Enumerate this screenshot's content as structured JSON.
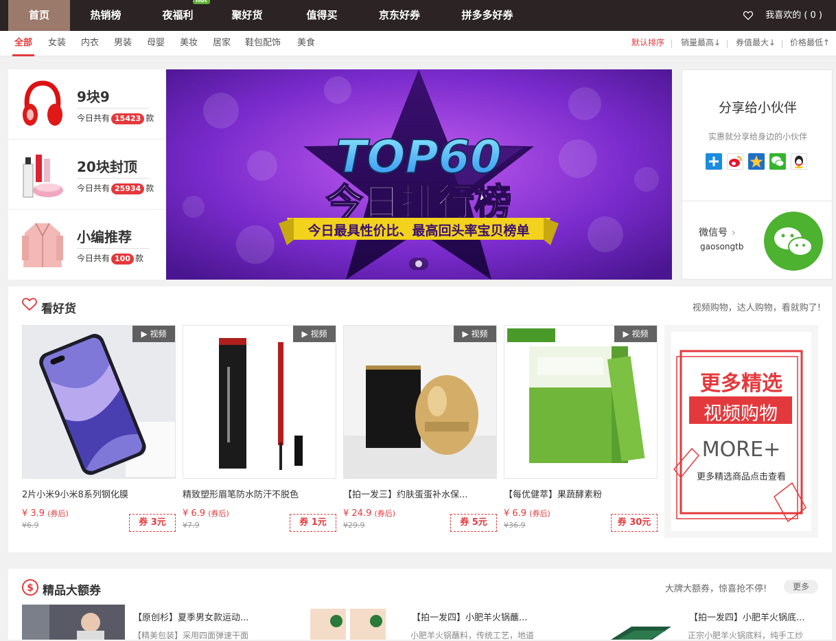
{
  "nav": {
    "items": [
      "首页",
      "热销榜",
      "夜福利",
      "聚好货",
      "值得买",
      "京东好券",
      "拼多多好券"
    ],
    "hot_tag": "hot",
    "favorites": "我喜欢的 ( 0 )"
  },
  "categories": [
    "全部",
    "女装",
    "内衣",
    "男装",
    "母婴",
    "美妆",
    "居家",
    "鞋包配饰",
    "美食"
  ],
  "sort": [
    "默认排序",
    "销量最高↓",
    "券值最大↓",
    "价格最低↑"
  ],
  "left_panel": [
    {
      "title": "9块9",
      "prefix": "今日共有",
      "count": "15423",
      "suffix": "款"
    },
    {
      "title": "20块封顶",
      "prefix": "今日共有",
      "count": "25934",
      "suffix": "款"
    },
    {
      "title": "小编推荐",
      "prefix": "今日共有",
      "count": "100",
      "suffix": "款"
    }
  ],
  "banner": {
    "headline": "TOP60",
    "title": "今日排行榜",
    "ribbon": "今日最具性价比、最高回头率宝贝榜单"
  },
  "share": {
    "title": "分享给小伙伴",
    "subtitle": "实惠就分享给身边的小伙伴",
    "wechat_label": "微信号",
    "wechat_id": "gaosongtb"
  },
  "section1": {
    "title": "看好货",
    "right": "视频购物，达人购物，看就购了!",
    "video_label": "视频",
    "products": [
      {
        "name": "2片小米9小米8系列钢化膜",
        "price": "¥ 3.9",
        "price_note": "(券后)",
        "orig": "¥6.9",
        "coupon": "券 3元"
      },
      {
        "name": "精致塑形眉笔防水防汗不脱色",
        "price": "¥ 6.9",
        "price_note": "(券后)",
        "orig": "¥7.9",
        "coupon": "券 1元"
      },
      {
        "name": "【拍一发三】约肤蛋蛋补水保...",
        "price": "¥ 24.9",
        "price_note": "(券后)",
        "orig": "¥29.9",
        "coupon": "券 5元"
      },
      {
        "name": "【每优健萃】果蔬酵素粉",
        "price": "¥ 6.9",
        "price_note": "(券后)",
        "orig": "¥36.9",
        "coupon": "券 30元"
      }
    ],
    "more": {
      "line1": "更多精选",
      "line2": "视频购物",
      "line3": "MORE+",
      "line4": "更多精选商品点击查看"
    }
  },
  "section2": {
    "title": "精品大额券",
    "right": "大牌大额券，惊喜抢不停!",
    "more": "更多",
    "items": [
      {
        "name": "【原创杉】夏季男女款运动...",
        "sub": "【精美包装】采用四面弹速干面"
      },
      {
        "name": "【拍一发四】小肥羊火锅蘸...",
        "sub": "小肥羊火锅蘸料，传统工艺，地道"
      },
      {
        "name": "【拍一发四】小肥羊火锅底...",
        "sub": "正宗小肥羊火锅底料，纯手工炒"
      }
    ]
  },
  "colors": {
    "accent": "#e4393c",
    "nav_bg": "#2b2324",
    "nav_active": "#9b7a6b",
    "hot_green": "#5fb336"
  }
}
